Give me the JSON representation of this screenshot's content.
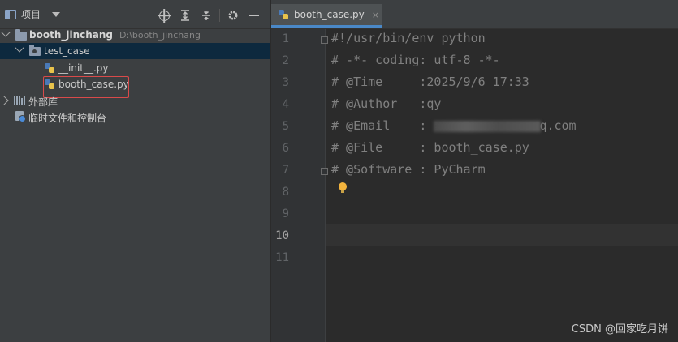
{
  "project_panel": {
    "title": "项目",
    "tree": {
      "root": {
        "name": "booth_jinchang",
        "path": "D:\\booth_jinchang"
      },
      "package": {
        "name": "test_case"
      },
      "files": [
        {
          "name": "__init__.py"
        },
        {
          "name": "booth_case.py"
        }
      ],
      "external_libraries": "外部库",
      "scratches": "临时文件和控制台"
    }
  },
  "editor": {
    "tab": {
      "label": "booth_case.py",
      "close": "×"
    },
    "line_numbers": [
      "1",
      "2",
      "3",
      "4",
      "5",
      "6",
      "7",
      "8",
      "9",
      "10",
      "11"
    ],
    "current_line": "10",
    "lines": [
      "#!/usr/bin/env python",
      "# -*- coding: utf-8 -*-",
      "# @Time     :2025/9/6 17:33",
      "# @Author   :qy",
      "# @Email    : ",
      "# @File     : booth_case.py",
      "# @Software : PyCharm"
    ],
    "email_suffix": "q.com"
  },
  "watermark": "CSDN @回家吃月饼",
  "colors": {
    "selection": "#0d293e",
    "highlight_box": "#d94a4a",
    "tab_underline": "#4a88c7",
    "bulb": "#f2b33d"
  }
}
